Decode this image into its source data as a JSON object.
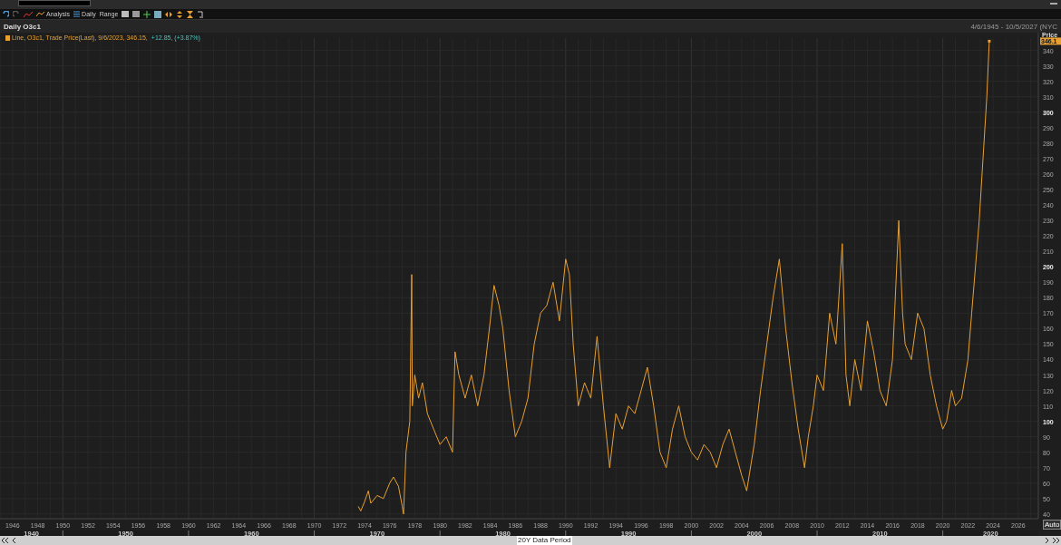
{
  "toolbar": {
    "items": [
      "Analysis",
      "Daily",
      "Range"
    ]
  },
  "chart_panel": {
    "title": "Daily O3c1",
    "date_range": "4/6/1945 - 10/5/2027 (NYC",
    "legend": {
      "prefix": "Line,",
      "text": ", Trade Price(Last), 9/6/2023, 346.15,",
      "change": "+12.85, (+3.87%)"
    },
    "axis_title": "Price",
    "last_price": "346.1",
    "auto_button": "Auto",
    "decade_labels": [
      "1940",
      "1950",
      "1960",
      "1970",
      "1980",
      "1990",
      "2000",
      "2010",
      "2020"
    ],
    "chart_data": {
      "type": "line",
      "grid": true,
      "xlim": [
        1945,
        2027.6
      ],
      "ylim": [
        37,
        348
      ],
      "xticks": [
        1946,
        1948,
        1950,
        1952,
        1954,
        1956,
        1958,
        1960,
        1962,
        1964,
        1966,
        1968,
        1970,
        1972,
        1974,
        1976,
        1978,
        1980,
        1982,
        1984,
        1986,
        1988,
        1990,
        1992,
        1994,
        1996,
        1998,
        2000,
        2002,
        2004,
        2006,
        2008,
        2010,
        2012,
        2014,
        2016,
        2018,
        2020,
        2022,
        2024,
        2026
      ],
      "yticks": [
        40,
        50,
        60,
        70,
        80,
        90,
        100,
        110,
        120,
        130,
        140,
        150,
        160,
        170,
        180,
        190,
        200,
        210,
        220,
        230,
        240,
        250,
        260,
        270,
        280,
        290,
        300,
        310,
        320,
        330,
        340
      ],
      "x": [
        1973.5,
        1973.7,
        1974,
        1974.3,
        1974.5,
        1975,
        1975.5,
        1976,
        1976.3,
        1976.7,
        1977,
        1977.1,
        1977.3,
        1977.6,
        1977.75,
        1977.8,
        1978,
        1978.3,
        1978.6,
        1979,
        1979.5,
        1980,
        1980.5,
        1981,
        1981.2,
        1981.5,
        1982,
        1982.5,
        1983,
        1983.5,
        1984,
        1984.3,
        1984.7,
        1985,
        1985.5,
        1986,
        1986.5,
        1987,
        1987.5,
        1988,
        1988.5,
        1989,
        1989.5,
        1990,
        1990.3,
        1990.6,
        1991,
        1991.5,
        1992,
        1992.5,
        1993,
        1993.5,
        1994,
        1994.5,
        1995,
        1995.5,
        1996,
        1996.5,
        1997,
        1997.5,
        1998,
        1998.5,
        1999,
        1999.5,
        2000,
        2000.5,
        2001,
        2001.5,
        2002,
        2002.5,
        2003,
        2003.5,
        2004,
        2004.4,
        2004.8,
        2005,
        2005.5,
        2006,
        2006.5,
        2007,
        2007.5,
        2008,
        2008.5,
        2009,
        2009.3,
        2009.7,
        2010,
        2010.5,
        2011,
        2011.5,
        2012,
        2012.3,
        2012.6,
        2013,
        2013.5,
        2014,
        2014.5,
        2015,
        2015.5,
        2016,
        2016.5,
        2016.8,
        2017,
        2017.5,
        2018,
        2018.5,
        2019,
        2019.5,
        2020,
        2020.3,
        2020.7,
        2021,
        2021.5,
        2022,
        2022.3,
        2022.6,
        2022.9,
        2023.2,
        2023.5,
        2023.7
      ],
      "series": [
        {
          "name": "O3c1",
          "color": "#e8a030",
          "values": [
            45,
            42,
            48,
            55,
            47,
            52,
            50,
            60,
            64,
            58,
            45,
            40,
            80,
            100,
            195,
            110,
            130,
            115,
            125,
            105,
            95,
            85,
            90,
            80,
            145,
            130,
            115,
            130,
            110,
            130,
            165,
            188,
            175,
            160,
            120,
            90,
            100,
            115,
            150,
            170,
            175,
            190,
            165,
            205,
            195,
            150,
            110,
            125,
            115,
            155,
            110,
            70,
            105,
            95,
            110,
            105,
            120,
            135,
            110,
            80,
            70,
            95,
            110,
            90,
            80,
            75,
            85,
            80,
            70,
            85,
            95,
            80,
            65,
            55,
            75,
            85,
            120,
            150,
            180,
            205,
            160,
            125,
            95,
            70,
            90,
            110,
            130,
            120,
            170,
            150,
            215,
            130,
            110,
            140,
            120,
            165,
            145,
            120,
            110,
            140,
            230,
            170,
            150,
            140,
            170,
            160,
            130,
            110,
            95,
            100,
            120,
            110,
            115,
            140,
            170,
            200,
            230,
            270,
            310,
            346
          ]
        }
      ]
    }
  },
  "scroll_bar": {
    "caption": "20Y Data Period"
  }
}
